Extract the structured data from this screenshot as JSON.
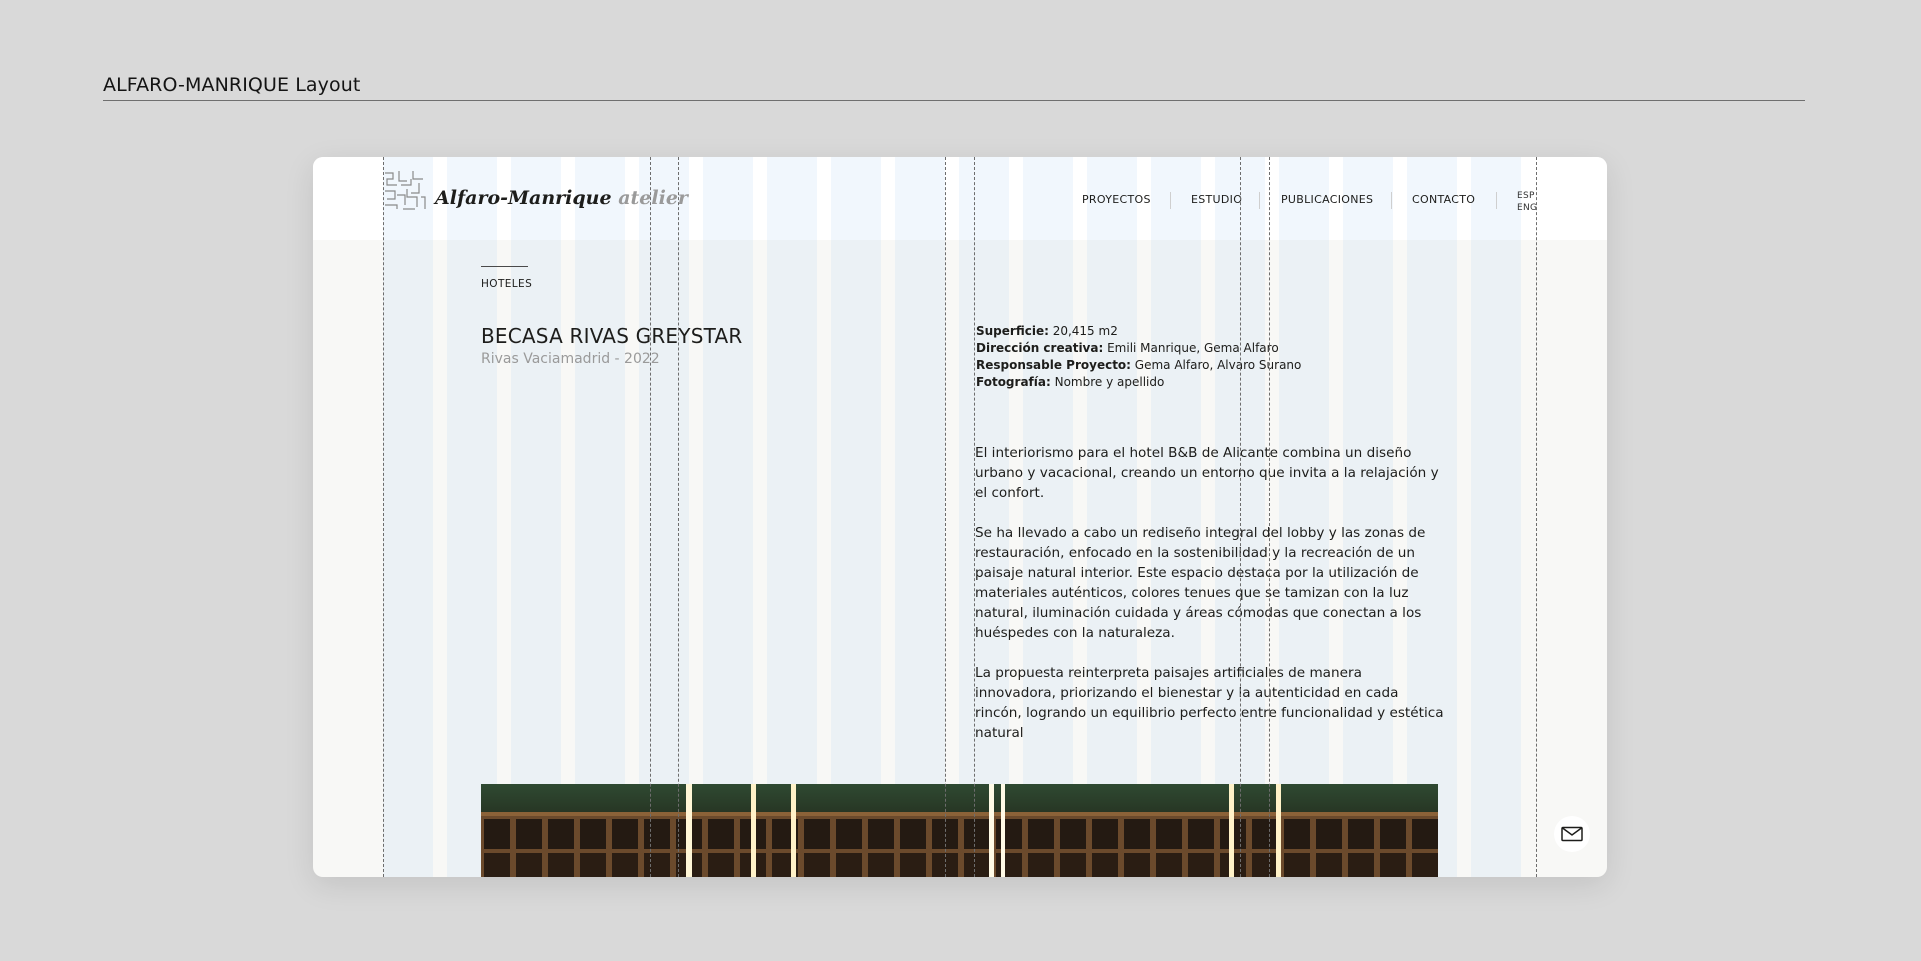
{
  "frame": {
    "title": "ALFARO-MANRIQUE Layout"
  },
  "header": {
    "logo_main": "Alfaro-Manrique",
    "logo_accent": "atelier",
    "nav": [
      "PROYECTOS",
      "ESTUDIO",
      "PUBLICACIONES",
      "CONTACTO"
    ],
    "lang": [
      "ESP",
      "ENG"
    ]
  },
  "project": {
    "category": "HOTELES",
    "title": "BECASA RIVAS GREYSTAR",
    "subtitle": "Rivas Vaciamadrid - 2022",
    "specs": [
      {
        "label": "Superficie:",
        "value": " 20,415 m2"
      },
      {
        "label": "Dirección creativa:",
        "value": " Emili Manrique, Gema Alfaro"
      },
      {
        "label": "Responsable Proyecto:",
        "value": " Gema Alfaro, Alvaro Surano"
      },
      {
        "label": "Fotografía:",
        "value": " Nombre y apellido"
      }
    ],
    "paragraphs": [
      "El interiorismo para el hotel B&B de Alicante combina un diseño urbano y vacacional, creando un entorno que invita a la relajación y el confort.",
      "Se ha llevado a cabo un rediseño integral del lobby y las zonas de restauración, enfocado en la sostenibilidad y la recreación de un paisaje natural interior. Este espacio destaca por la utilización de materiales auténticos, colores tenues que se tamizan con la luz natural, iluminación cuidada y áreas cómodas que conectan a los huéspedes con la naturaleza.",
      "La propuesta reinterpreta paisajes artificiales de manera innovadora, priorizando el bienestar y la autenticidad en cada rincón, logrando un equilibrio perfecto entre funcionalidad y estética natural"
    ]
  },
  "icons": {
    "mail": "envelope-icon",
    "logo": "logo-mark-icon"
  },
  "colors": {
    "background": "#d9d9d9",
    "artboard": "#f8f8f6",
    "grid": "#a8cdf0",
    "text": "#1d1d1b",
    "muted": "#9a9a9a"
  }
}
